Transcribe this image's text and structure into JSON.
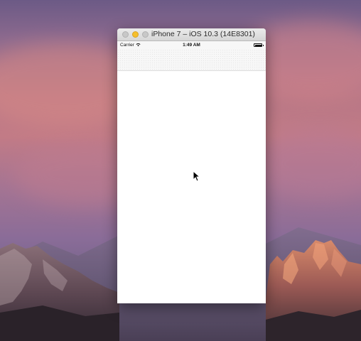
{
  "desktop": {
    "wallpaper": "macOS Sierra mountain wallpaper"
  },
  "window": {
    "title": "iPhone 7 – iOS 10.3 (14E8301)",
    "traffic_lights": [
      "close-icon",
      "minimize-icon",
      "zoom-icon"
    ],
    "minimize_color": "#f5bf2d"
  },
  "status_bar": {
    "carrier": "Carrier",
    "wifi_icon": "wifi-icon",
    "time": "1:49 AM",
    "battery_icon": "battery-icon",
    "battery_level": 1.0
  },
  "navigation_bar": {
    "title": ""
  },
  "content": {
    "placeholder": ""
  },
  "cursor": {
    "icon": "arrow-cursor-icon"
  }
}
